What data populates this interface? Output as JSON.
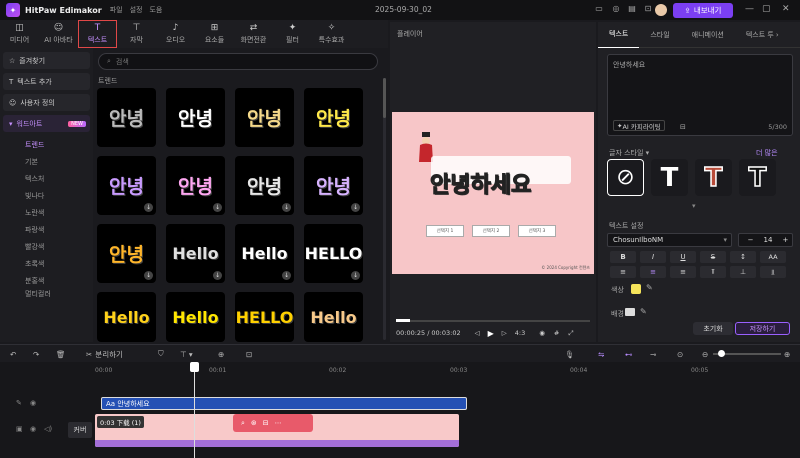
{
  "app": {
    "name": "HitPaw Edimakor",
    "menus": [
      "파일",
      "설정",
      "도움"
    ],
    "project": "2025-09-30_02",
    "export_label": "내보내기"
  },
  "top_tabs": [
    {
      "label": "미디어",
      "icon": "media-icon"
    },
    {
      "label": "AI 아바타",
      "icon": "avatar-icon"
    },
    {
      "label": "텍스트",
      "icon": "text-icon"
    },
    {
      "label": "자막",
      "icon": "subtitle-icon"
    },
    {
      "label": "오디오",
      "icon": "music-icon"
    },
    {
      "label": "요소들",
      "icon": "elements-icon"
    },
    {
      "label": "화면전환",
      "icon": "transition-icon"
    },
    {
      "label": "필터",
      "icon": "filter-icon"
    },
    {
      "label": "특수효과",
      "icon": "effects-icon"
    }
  ],
  "left_nav": {
    "items": [
      {
        "label": "즐겨찾기",
        "icon": "star-icon"
      },
      {
        "label": "텍스트 추가",
        "icon": "text-add-icon"
      },
      {
        "label": "사용자 정의",
        "icon": "user-icon"
      }
    ],
    "wordart": {
      "label": "워드아트",
      "badge": "NEW"
    },
    "subs": [
      "트렌드",
      "기본",
      "텍스처",
      "빛나다",
      "노란색",
      "파랑색",
      "빨강색",
      "초록색",
      "분홍색",
      "멀티컬러"
    ]
  },
  "grid": {
    "search_placeholder": "검색",
    "section": "트렌드",
    "tiles": [
      {
        "text": "안녕",
        "color": "#bbbbbb"
      },
      {
        "text": "안녕",
        "color": "#ffffff"
      },
      {
        "text": "안녕",
        "color": "#f5d98a"
      },
      {
        "text": "안녕",
        "color": "#ffe94a"
      },
      {
        "text": "안녕",
        "color": "#c99bff"
      },
      {
        "text": "안녕",
        "color": "#ffa7f2"
      },
      {
        "text": "안녕",
        "color": "#e8e8e8"
      },
      {
        "text": "안녕",
        "color": "#d7b3ff"
      },
      {
        "text": "안녕",
        "color": "#ffb62a"
      },
      {
        "text": "Hello",
        "color": "#e0e0e0"
      },
      {
        "text": "Hello",
        "color": "#ffffff"
      },
      {
        "text": "HELLO",
        "color": "#ffffff"
      },
      {
        "text": "Hello",
        "color": "#ffd21a"
      },
      {
        "text": "Hello",
        "color": "#ffe600"
      },
      {
        "text": "HELLO",
        "color": "#ffd100"
      },
      {
        "text": "Hello",
        "color": "#f7c98a"
      }
    ]
  },
  "player": {
    "label": "플레이어",
    "main_text": "안녕하세요",
    "current": "00:00:25",
    "total": "00:03:02",
    "ratio": "4:3",
    "buttons": [
      "선택지 1",
      "선택지 2",
      "선택지 3"
    ],
    "credit": "© 2024 Copyright 컨텐츠"
  },
  "right_panel": {
    "tabs": [
      "텍스트",
      "스타일",
      "애니메이션",
      "텍스트 투"
    ],
    "text_value": "안녕하세요",
    "ai_label": "AI 카피라이팅",
    "count": "5/300",
    "font_style_label": "글자 스타일",
    "more_label": "더 많은",
    "text_settings_label": "텍스트 설정",
    "font": "ChosunIlboNM",
    "size": "14",
    "color_label": "색상",
    "bg_label": "배경",
    "reset_label": "초기화",
    "save_label": "저장하기"
  },
  "toolbar": {
    "split_label": "분리하기"
  },
  "timeline": {
    "ticks": [
      "00:00",
      "00:01",
      "00:02",
      "00:03",
      "00:04",
      "00:05"
    ],
    "text_clip": "안녕하세요",
    "video_clip_label": "0:03 下载 (1)",
    "cover_label": "커버"
  }
}
